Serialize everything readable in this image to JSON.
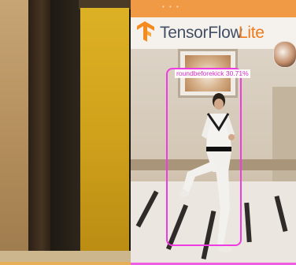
{
  "app": {
    "brand_primary": "TensorFlow",
    "brand_secondary": "Lite",
    "accent_color": "#ee7a1c",
    "status_bar_color": "#f19a46"
  },
  "detection": {
    "label": "roundbeforekick 30.71%",
    "box_color": "#ee3ce2"
  },
  "icons": {
    "logo": "tensorflow-logo-icon"
  }
}
